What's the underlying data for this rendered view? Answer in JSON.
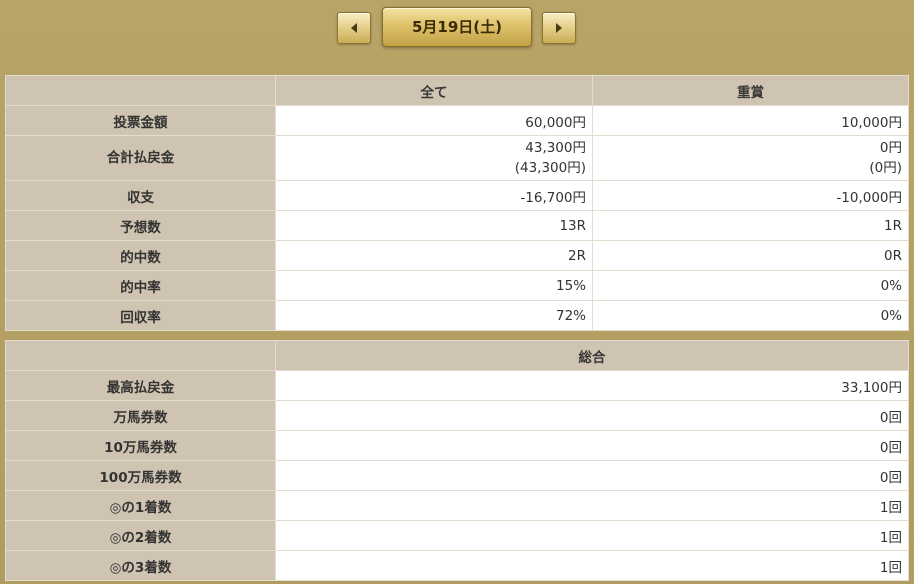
{
  "nav": {
    "date": "5月19日(土)"
  },
  "summary": {
    "headers": [
      "全て",
      "重賞"
    ],
    "rows": [
      {
        "label": "投票金額",
        "all": "60,000円",
        "graded": "10,000円"
      },
      {
        "label": "合計払戻金",
        "all": "43,300円",
        "all_sub": "(43,300円)",
        "graded": "0円",
        "graded_sub": "(0円)"
      },
      {
        "label": "収支",
        "all": "-16,700円",
        "graded": "-10,000円"
      },
      {
        "label": "予想数",
        "all": "13R",
        "graded": "1R"
      },
      {
        "label": "的中数",
        "all": "2R",
        "graded": "0R"
      },
      {
        "label": "的中率",
        "all": "15%",
        "graded": "0%"
      },
      {
        "label": "回収率",
        "all": "72%",
        "graded": "0%"
      }
    ]
  },
  "totals": {
    "header": "総合",
    "rows": [
      {
        "label": "最高払戻金",
        "value": "33,100円"
      },
      {
        "label": "万馬券数",
        "value": "0回"
      },
      {
        "label": "10万馬券数",
        "value": "0回"
      },
      {
        "label": "100万馬券数",
        "value": "0回"
      },
      {
        "label": "◎の1着数",
        "value": "1回"
      },
      {
        "label": "◎の2着数",
        "value": "1回"
      },
      {
        "label": "◎の3着数",
        "value": "1回"
      }
    ]
  }
}
